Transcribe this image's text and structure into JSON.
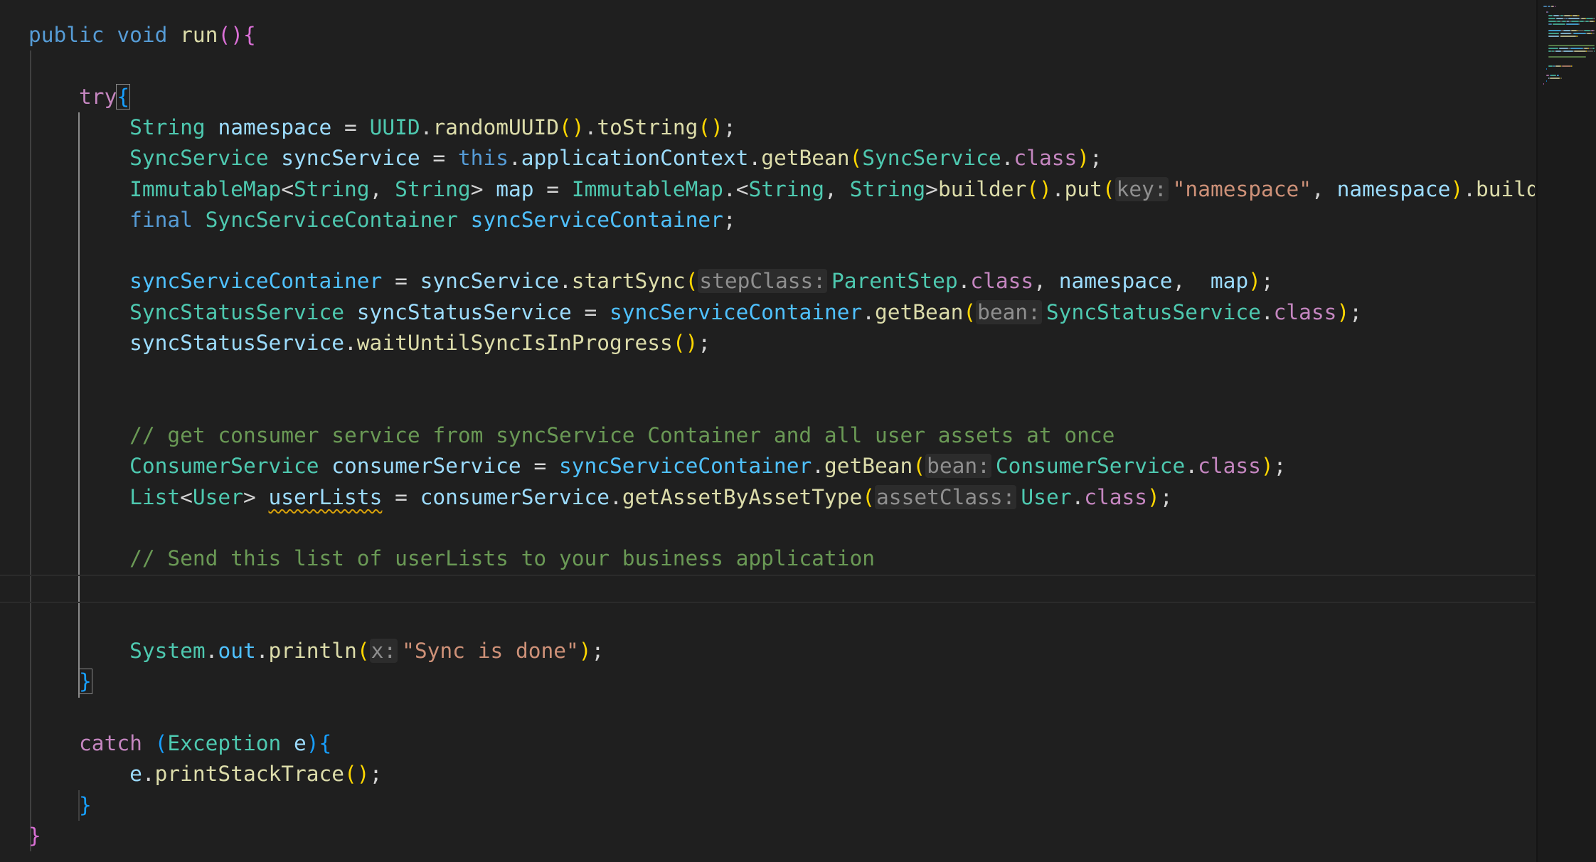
{
  "editor": {
    "lines": [
      {
        "id": "run-signature",
        "tokens": [
          {
            "t": "public",
            "c": "kw"
          },
          {
            "t": " ",
            "c": "pn"
          },
          {
            "t": "void",
            "c": "kw"
          },
          {
            "t": " ",
            "c": "pn"
          },
          {
            "t": "run",
            "c": "fn"
          },
          {
            "t": "()",
            "c": "b2"
          },
          {
            "t": "{",
            "c": "b2"
          }
        ]
      },
      {
        "id": "blank-1",
        "tokens": []
      },
      {
        "id": "try-open",
        "tokens": [
          {
            "t": "    ",
            "c": "pn"
          },
          {
            "t": "try",
            "c": "cf"
          },
          {
            "t": "{",
            "c": "b3",
            "m": true
          }
        ]
      },
      {
        "id": "namespace-decl",
        "tokens": [
          {
            "t": "        ",
            "c": "pn"
          },
          {
            "t": "String",
            "c": "ty"
          },
          {
            "t": " ",
            "c": "pn"
          },
          {
            "t": "namespace",
            "c": "var"
          },
          {
            "t": " = ",
            "c": "pn"
          },
          {
            "t": "UUID",
            "c": "ty"
          },
          {
            "t": ".",
            "c": "pn"
          },
          {
            "t": "randomUUID",
            "c": "fn"
          },
          {
            "t": "()",
            "c": "b1"
          },
          {
            "t": ".",
            "c": "pn"
          },
          {
            "t": "toString",
            "c": "fn"
          },
          {
            "t": "()",
            "c": "b1"
          },
          {
            "t": ";",
            "c": "pn"
          }
        ]
      },
      {
        "id": "syncservice-decl",
        "tokens": [
          {
            "t": "        ",
            "c": "pn"
          },
          {
            "t": "SyncService",
            "c": "ty"
          },
          {
            "t": " ",
            "c": "pn"
          },
          {
            "t": "syncService",
            "c": "var"
          },
          {
            "t": " = ",
            "c": "pn"
          },
          {
            "t": "this",
            "c": "kw"
          },
          {
            "t": ".",
            "c": "pn"
          },
          {
            "t": "applicationContext",
            "c": "var"
          },
          {
            "t": ".",
            "c": "pn"
          },
          {
            "t": "getBean",
            "c": "fn"
          },
          {
            "t": "(",
            "c": "b1"
          },
          {
            "t": "SyncService",
            "c": "ty"
          },
          {
            "t": ".",
            "c": "pn"
          },
          {
            "t": "class",
            "c": "cf"
          },
          {
            "t": ")",
            "c": "b1"
          },
          {
            "t": ";",
            "c": "pn"
          }
        ]
      },
      {
        "id": "map-decl",
        "tokens": [
          {
            "t": "        ",
            "c": "pn"
          },
          {
            "t": "ImmutableMap",
            "c": "ty"
          },
          {
            "t": "<",
            "c": "pn"
          },
          {
            "t": "String",
            "c": "ty"
          },
          {
            "t": ", ",
            "c": "pn"
          },
          {
            "t": "String",
            "c": "ty"
          },
          {
            "t": "> ",
            "c": "pn"
          },
          {
            "t": "map",
            "c": "var"
          },
          {
            "t": " = ",
            "c": "pn"
          },
          {
            "t": "ImmutableMap",
            "c": "ty"
          },
          {
            "t": ".<",
            "c": "pn"
          },
          {
            "t": "String",
            "c": "ty"
          },
          {
            "t": ", ",
            "c": "pn"
          },
          {
            "t": "String",
            "c": "ty"
          },
          {
            "t": ">",
            "c": "pn"
          },
          {
            "t": "builder",
            "c": "fn"
          },
          {
            "t": "()",
            "c": "b1"
          },
          {
            "t": ".",
            "c": "pn"
          },
          {
            "t": "put",
            "c": "fn"
          },
          {
            "t": "(",
            "c": "b1"
          },
          {
            "t": "key:",
            "c": "hint"
          },
          {
            "t": "\"namespace\"",
            "c": "str"
          },
          {
            "t": ", ",
            "c": "pn"
          },
          {
            "t": "namespace",
            "c": "var"
          },
          {
            "t": ")",
            "c": "b1"
          },
          {
            "t": ".",
            "c": "pn"
          },
          {
            "t": "build",
            "c": "fn"
          },
          {
            "t": "()",
            "c": "b1"
          },
          {
            "t": ";",
            "c": "pn"
          }
        ]
      },
      {
        "id": "container-decl",
        "tokens": [
          {
            "t": "        ",
            "c": "pn"
          },
          {
            "t": "final",
            "c": "kw"
          },
          {
            "t": " ",
            "c": "pn"
          },
          {
            "t": "SyncServiceContainer",
            "c": "ty"
          },
          {
            "t": " ",
            "c": "pn"
          },
          {
            "t": "syncServiceContainer",
            "c": "pp"
          },
          {
            "t": ";",
            "c": "pn"
          }
        ]
      },
      {
        "id": "blank-2",
        "tokens": []
      },
      {
        "id": "start-sync",
        "tokens": [
          {
            "t": "        ",
            "c": "pn"
          },
          {
            "t": "syncServiceContainer",
            "c": "pp"
          },
          {
            "t": " = ",
            "c": "pn"
          },
          {
            "t": "syncService",
            "c": "var"
          },
          {
            "t": ".",
            "c": "pn"
          },
          {
            "t": "startSync",
            "c": "fn"
          },
          {
            "t": "(",
            "c": "b1"
          },
          {
            "t": "stepClass:",
            "c": "hint"
          },
          {
            "t": "ParentStep",
            "c": "ty"
          },
          {
            "t": ".",
            "c": "pn"
          },
          {
            "t": "class",
            "c": "cf"
          },
          {
            "t": ", ",
            "c": "pn"
          },
          {
            "t": "namespace",
            "c": "var"
          },
          {
            "t": ",  ",
            "c": "pn"
          },
          {
            "t": "map",
            "c": "var"
          },
          {
            "t": ")",
            "c": "b1"
          },
          {
            "t": ";",
            "c": "pn"
          }
        ]
      },
      {
        "id": "status-service-decl",
        "tokens": [
          {
            "t": "        ",
            "c": "pn"
          },
          {
            "t": "SyncStatusService",
            "c": "ty"
          },
          {
            "t": " ",
            "c": "pn"
          },
          {
            "t": "syncStatusService",
            "c": "var"
          },
          {
            "t": " = ",
            "c": "pn"
          },
          {
            "t": "syncServiceContainer",
            "c": "pp"
          },
          {
            "t": ".",
            "c": "pn"
          },
          {
            "t": "getBean",
            "c": "fn"
          },
          {
            "t": "(",
            "c": "b1"
          },
          {
            "t": "bean:",
            "c": "hint"
          },
          {
            "t": "SyncStatusService",
            "c": "ty"
          },
          {
            "t": ".",
            "c": "pn"
          },
          {
            "t": "class",
            "c": "cf"
          },
          {
            "t": ")",
            "c": "b1"
          },
          {
            "t": ";",
            "c": "pn"
          }
        ]
      },
      {
        "id": "wait-until",
        "tokens": [
          {
            "t": "        ",
            "c": "pn"
          },
          {
            "t": "syncStatusService",
            "c": "var"
          },
          {
            "t": ".",
            "c": "pn"
          },
          {
            "t": "waitUntilSyncIsInProgress",
            "c": "fn"
          },
          {
            "t": "()",
            "c": "b1"
          },
          {
            "t": ";",
            "c": "pn"
          }
        ]
      },
      {
        "id": "blank-3",
        "tokens": []
      },
      {
        "id": "blank-4",
        "tokens": []
      },
      {
        "id": "comment-consumer",
        "tokens": [
          {
            "t": "        ",
            "c": "pn"
          },
          {
            "t": "// get consumer service from syncService Container and all user assets at once",
            "c": "cm"
          }
        ]
      },
      {
        "id": "consumer-decl",
        "tokens": [
          {
            "t": "        ",
            "c": "pn"
          },
          {
            "t": "ConsumerService",
            "c": "ty"
          },
          {
            "t": " ",
            "c": "pn"
          },
          {
            "t": "consumerService",
            "c": "var"
          },
          {
            "t": " = ",
            "c": "pn"
          },
          {
            "t": "syncServiceContainer",
            "c": "pp"
          },
          {
            "t": ".",
            "c": "pn"
          },
          {
            "t": "getBean",
            "c": "fn"
          },
          {
            "t": "(",
            "c": "b1"
          },
          {
            "t": "bean:",
            "c": "hint"
          },
          {
            "t": "ConsumerService",
            "c": "ty"
          },
          {
            "t": ".",
            "c": "pn"
          },
          {
            "t": "class",
            "c": "cf"
          },
          {
            "t": ")",
            "c": "b1"
          },
          {
            "t": ";",
            "c": "pn"
          }
        ]
      },
      {
        "id": "userlists-decl",
        "tokens": [
          {
            "t": "        ",
            "c": "pn"
          },
          {
            "t": "List",
            "c": "ty"
          },
          {
            "t": "<",
            "c": "pn"
          },
          {
            "t": "User",
            "c": "ty"
          },
          {
            "t": "> ",
            "c": "pn"
          },
          {
            "t": "userLists",
            "c": "var",
            "w": true
          },
          {
            "t": " = ",
            "c": "pn"
          },
          {
            "t": "consumerService",
            "c": "var"
          },
          {
            "t": ".",
            "c": "pn"
          },
          {
            "t": "getAssetByAssetType",
            "c": "fn"
          },
          {
            "t": "(",
            "c": "b1"
          },
          {
            "t": "assetClass:",
            "c": "hint"
          },
          {
            "t": "User",
            "c": "ty"
          },
          {
            "t": ".",
            "c": "pn"
          },
          {
            "t": "class",
            "c": "cf"
          },
          {
            "t": ")",
            "c": "b1"
          },
          {
            "t": ";",
            "c": "pn"
          }
        ]
      },
      {
        "id": "blank-5",
        "tokens": []
      },
      {
        "id": "comment-send",
        "tokens": [
          {
            "t": "        ",
            "c": "pn"
          },
          {
            "t": "// Send this list of userLists to your business application",
            "c": "cm"
          }
        ]
      },
      {
        "id": "blank-6",
        "tokens": []
      },
      {
        "id": "blank-7",
        "tokens": []
      },
      {
        "id": "println",
        "tokens": [
          {
            "t": "        ",
            "c": "pn"
          },
          {
            "t": "System",
            "c": "ty"
          },
          {
            "t": ".",
            "c": "pn"
          },
          {
            "t": "out",
            "c": "pp"
          },
          {
            "t": ".",
            "c": "pn"
          },
          {
            "t": "println",
            "c": "fn"
          },
          {
            "t": "(",
            "c": "b1"
          },
          {
            "t": "x:",
            "c": "hint"
          },
          {
            "t": "\"Sync is done\"",
            "c": "str"
          },
          {
            "t": ")",
            "c": "b1"
          },
          {
            "t": ";",
            "c": "pn"
          }
        ]
      },
      {
        "id": "try-close",
        "tokens": [
          {
            "t": "    ",
            "c": "pn"
          },
          {
            "t": "}",
            "c": "b3",
            "m": true
          }
        ]
      },
      {
        "id": "blank-8",
        "tokens": []
      },
      {
        "id": "catch-open",
        "tokens": [
          {
            "t": "    ",
            "c": "pn"
          },
          {
            "t": "catch",
            "c": "cf"
          },
          {
            "t": " ",
            "c": "pn"
          },
          {
            "t": "(",
            "c": "b3"
          },
          {
            "t": "Exception",
            "c": "ty"
          },
          {
            "t": " ",
            "c": "pn"
          },
          {
            "t": "e",
            "c": "var"
          },
          {
            "t": ")",
            "c": "b3"
          },
          {
            "t": "{",
            "c": "b3"
          }
        ]
      },
      {
        "id": "print-stack",
        "tokens": [
          {
            "t": "        ",
            "c": "pn"
          },
          {
            "t": "e",
            "c": "var"
          },
          {
            "t": ".",
            "c": "pn"
          },
          {
            "t": "printStackTrace",
            "c": "fn"
          },
          {
            "t": "()",
            "c": "b1"
          },
          {
            "t": ";",
            "c": "pn"
          }
        ]
      },
      {
        "id": "catch-close",
        "tokens": [
          {
            "t": "    ",
            "c": "pn"
          },
          {
            "t": "}",
            "c": "b3"
          }
        ]
      },
      {
        "id": "run-close",
        "tokens": [
          {
            "t": "}",
            "c": "b2"
          }
        ]
      }
    ],
    "current_line": 18
  },
  "colors": {
    "background": "#1f1f1f",
    "keyword": "#569cd6",
    "control": "#c586c0",
    "type": "#4ec9b0",
    "function": "#dcdcaa",
    "variable": "#9cdcfe",
    "string": "#ce9178",
    "comment": "#6a9955",
    "bracket_1": "#ffd700",
    "bracket_2": "#da70d6",
    "bracket_3": "#179fff",
    "warning_squiggle": "#d7a10b"
  }
}
